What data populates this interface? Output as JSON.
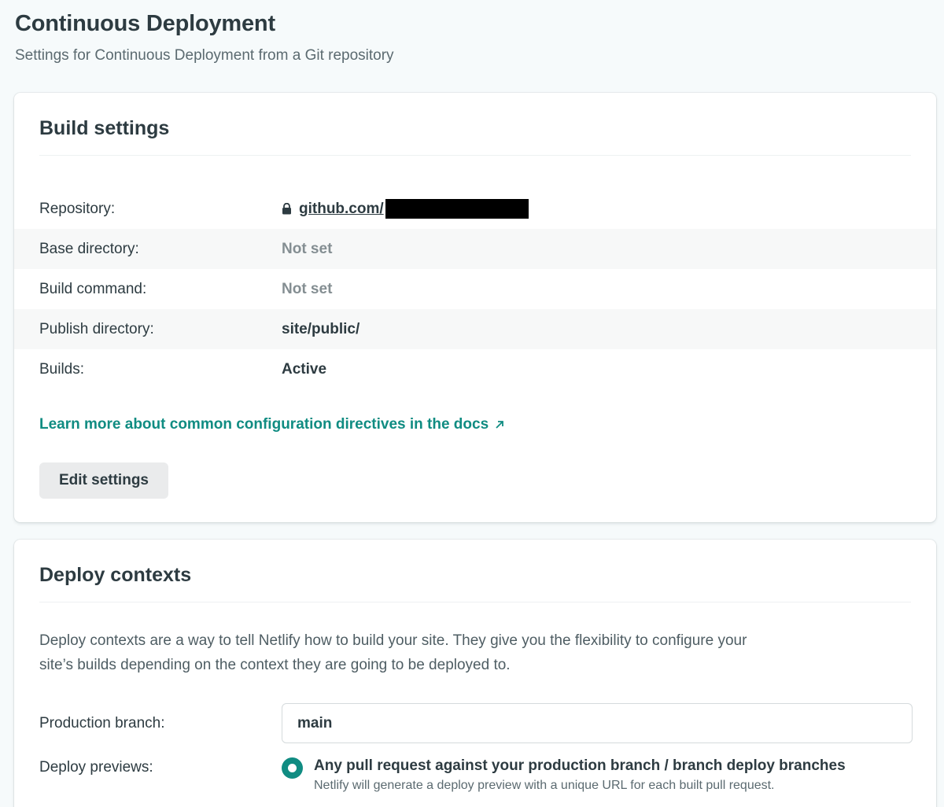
{
  "header": {
    "title": "Continuous Deployment",
    "subtitle": "Settings for Continuous Deployment from a Git repository"
  },
  "build_settings": {
    "title": "Build settings",
    "rows": [
      {
        "label": "Repository:",
        "value": "github.com/"
      },
      {
        "label": "Base directory:",
        "value": "Not set"
      },
      {
        "label": "Build command:",
        "value": "Not set"
      },
      {
        "label": "Publish directory:",
        "value": "site/public/"
      },
      {
        "label": "Builds:",
        "value": "Active"
      }
    ],
    "docs_link": "Learn more about common configuration directives in the docs",
    "edit_button": "Edit settings"
  },
  "deploy_contexts": {
    "title": "Deploy contexts",
    "description": "Deploy contexts are a way to tell Netlify how to build your site. They give you the flexibility to configure your site’s builds depending on the context they are going to be deployed to.",
    "production_branch_label": "Production branch:",
    "production_branch_value": "main",
    "deploy_previews_label": "Deploy previews:",
    "deploy_previews_option": "Any pull request against your production branch / branch deploy branches",
    "deploy_previews_desc": "Netlify will generate a deploy preview with a unique URL for each built pull request."
  },
  "icons": {
    "lock": "lock-icon",
    "external_link": "arrow-up-right-icon",
    "radio": "radio-selected-icon"
  },
  "colors": {
    "accent": "#108c82",
    "text": "#2d3b41",
    "muted": "#848e92",
    "background": "#f6fafb"
  }
}
